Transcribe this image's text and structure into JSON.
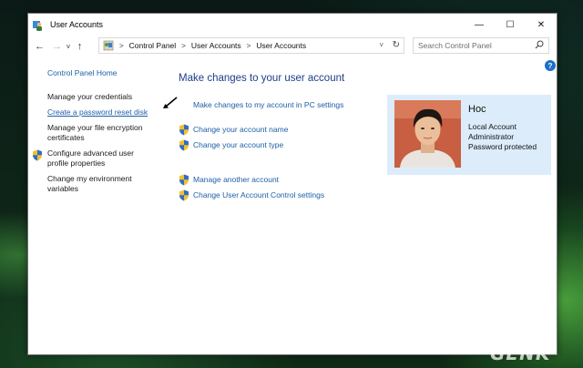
{
  "window": {
    "title": "User Accounts",
    "controls": {
      "minimize": "—",
      "maximize": "☐",
      "close": "✕"
    }
  },
  "nav": {
    "back": "←",
    "forward": "→",
    "recent": "˅",
    "up": "↑"
  },
  "address": {
    "crumbs": [
      "Control Panel",
      "User Accounts",
      "User Accounts"
    ],
    "separator": ">",
    "dropdown": "˅",
    "refresh": "↻"
  },
  "search": {
    "placeholder": "Search Control Panel",
    "icon": "⚲"
  },
  "help": {
    "label": "?"
  },
  "sidebar": {
    "home": "Control Panel Home",
    "items": [
      "Manage your credentials",
      "Create a password reset disk",
      "Manage your file encryption",
      "certificates",
      "Configure advanced user",
      "profile properties",
      "Change my environment",
      "variables"
    ]
  },
  "main": {
    "heading": "Make changes to your user account",
    "pc_settings_link": "Make changes to my account in PC settings",
    "links": [
      "Change your account name",
      "Change your account type",
      "Manage another account",
      "Change User Account Control settings"
    ]
  },
  "user": {
    "name": "Hoc",
    "details": [
      "Local Account",
      "Administrator",
      "Password protected"
    ]
  },
  "watermark": "GENK",
  "colors": {
    "link": "#1d5fa8",
    "heading": "#1d3d8b",
    "card": "#dcecfb",
    "help": "#1e6fc9"
  }
}
